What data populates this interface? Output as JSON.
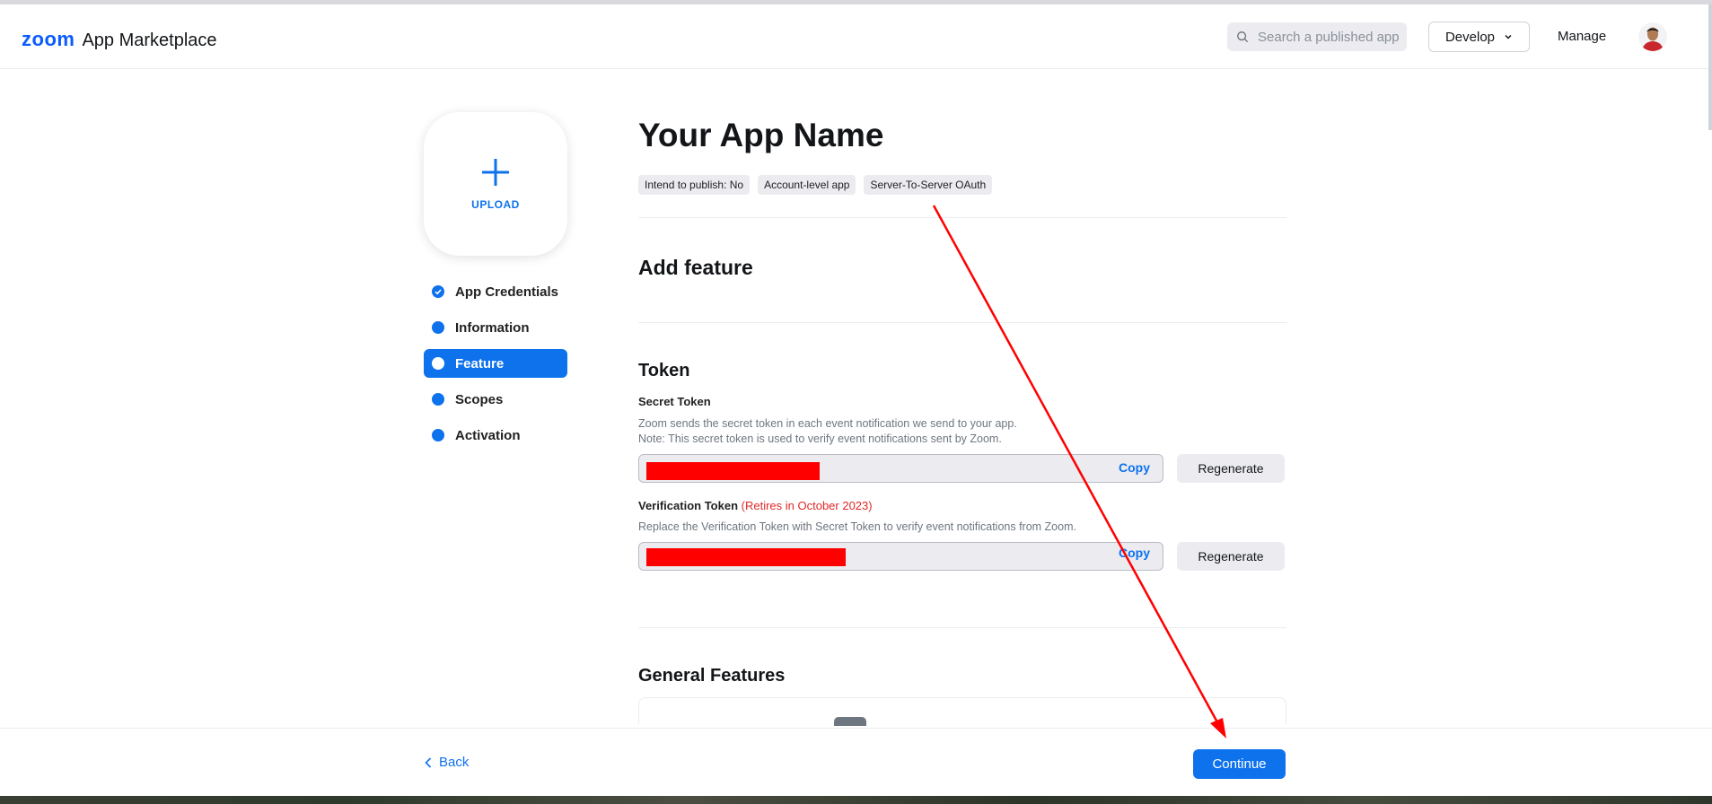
{
  "header": {
    "logo_brand": "zoom",
    "logo_text": "App Marketplace",
    "search_placeholder": "Search a published app",
    "develop_label": "Develop",
    "manage_label": "Manage"
  },
  "sidebar": {
    "upload_label": "UPLOAD",
    "items": [
      {
        "label": "App Credentials",
        "state": "completed"
      },
      {
        "label": "Information",
        "state": "default"
      },
      {
        "label": "Feature",
        "state": "active"
      },
      {
        "label": "Scopes",
        "state": "default"
      },
      {
        "label": "Activation",
        "state": "default"
      }
    ]
  },
  "main": {
    "app_name": "Your App Name",
    "tags": [
      "Intend to publish: No",
      "Account-level app",
      "Server-To-Server OAuth"
    ],
    "add_feature_title": "Add feature",
    "token_section_title": "Token",
    "secret_token": {
      "title": "Secret Token",
      "desc_line1": "Zoom sends the secret token in each event notification we send to your app.",
      "desc_line2": "Note: This secret token is used to verify event notifications sent by Zoom.",
      "copy_label": "Copy",
      "regenerate_label": "Regenerate"
    },
    "verification_token": {
      "title": "Verification Token",
      "retire_note": "(Retires in October 2023)",
      "desc": "Replace the Verification Token with Secret Token to verify event notifications from Zoom.",
      "copy_label": "Copy",
      "regenerate_label": "Regenerate"
    },
    "general_features_title": "General Features"
  },
  "footer": {
    "back_label": "Back",
    "continue_label": "Continue"
  },
  "colors": {
    "accent": "#0e72ed",
    "annotation": "#ff0000",
    "warning_text": "#e02828"
  }
}
